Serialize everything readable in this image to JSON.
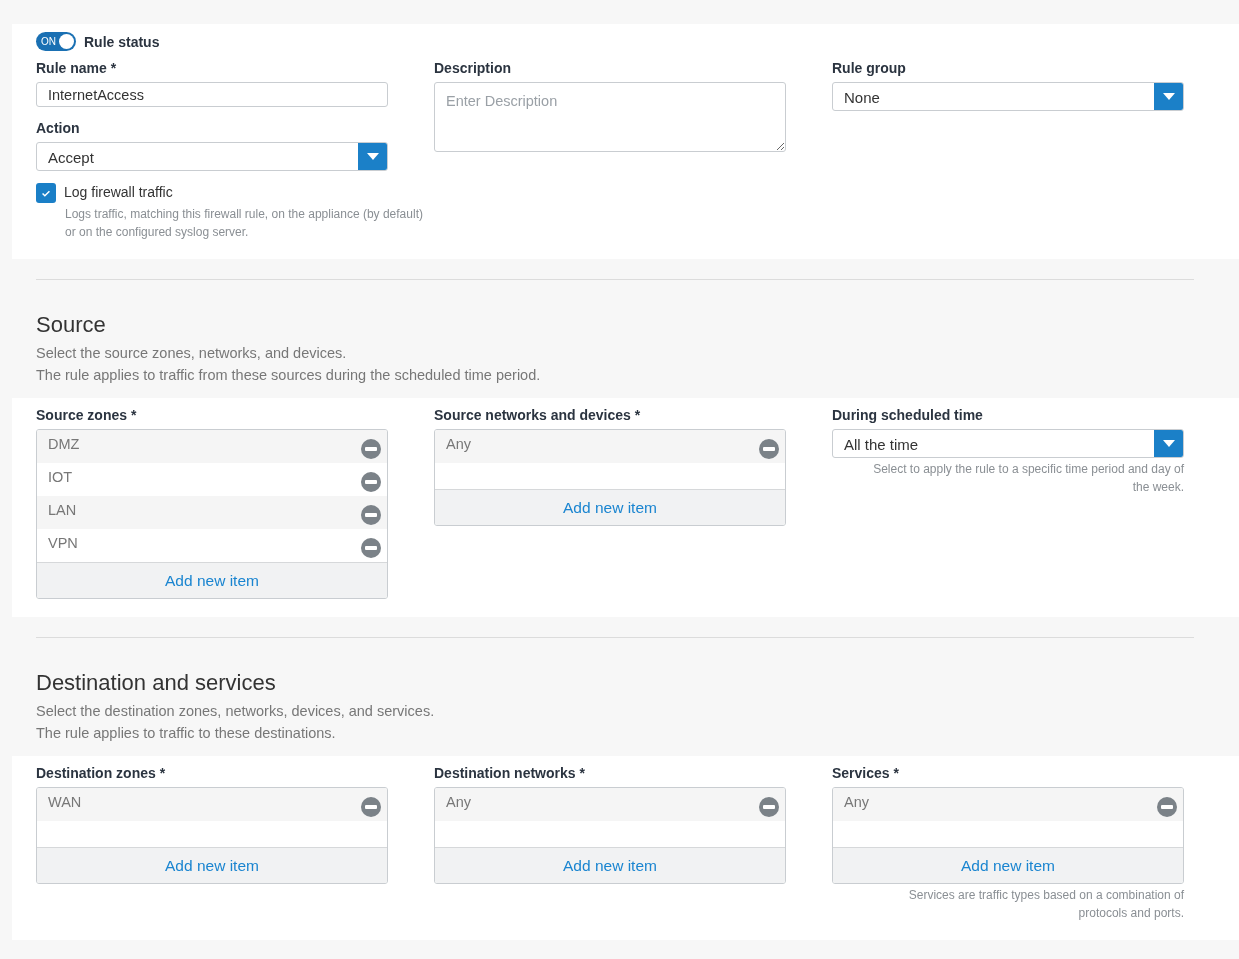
{
  "general": {
    "rule_status": {
      "label": "Rule status",
      "on": true,
      "switch_text": "ON"
    },
    "rule_name": {
      "label": "Rule name *",
      "value": "InternetAccess"
    },
    "action": {
      "label": "Action",
      "value": "Accept"
    },
    "log": {
      "label": "Log firewall traffic",
      "checked": true,
      "help": "Logs traffic, matching this firewall rule, on the appliance (by default) or on the configured syslog server."
    },
    "description": {
      "label": "Description",
      "placeholder": "Enter Description"
    },
    "rule_group": {
      "label": "Rule group",
      "value": "None"
    }
  },
  "sections": [
    {
      "title": "Source",
      "lines": [
        "Select the source zones, networks, and devices.",
        "The rule applies to traffic from these sources during the scheduled time period."
      ],
      "fields": [
        {
          "kind": "list",
          "label": "Source zones *",
          "items": [
            "DMZ",
            "IOT",
            "LAN",
            "VPN"
          ],
          "add": "Add new item"
        },
        {
          "kind": "list",
          "label": "Source networks and devices *",
          "items": [
            "Any"
          ],
          "add": "Add new item"
        },
        {
          "kind": "select",
          "label": "During scheduled time",
          "value": "All the time",
          "help": "Select to apply the rule to a specific time period and day of the week."
        }
      ]
    },
    {
      "title": "Destination and services",
      "lines": [
        "Select the destination zones, networks, devices, and services.",
        "The rule applies to traffic to these destinations."
      ],
      "fields": [
        {
          "kind": "list",
          "label": "Destination zones *",
          "items": [
            "WAN"
          ],
          "add": "Add new item"
        },
        {
          "kind": "list",
          "label": "Destination networks *",
          "items": [
            "Any"
          ],
          "add": "Add new item"
        },
        {
          "kind": "list",
          "label": "Services *",
          "items": [
            "Any"
          ],
          "add": "Add new item",
          "help": "Services are traffic types based on a combination of protocols and ports."
        }
      ]
    }
  ]
}
